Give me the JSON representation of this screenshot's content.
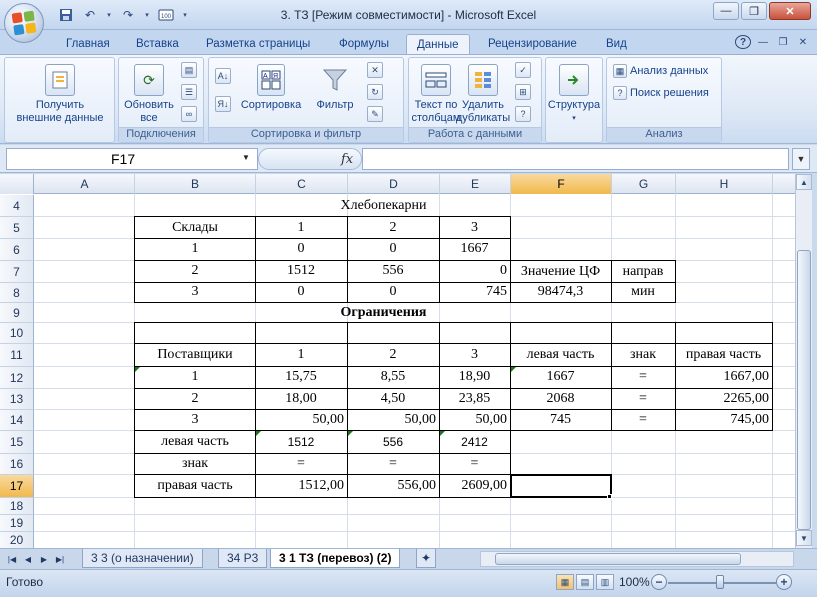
{
  "window": {
    "title": "3. ТЗ  [Режим совместимости] - Microsoft Excel"
  },
  "ribbon_tabs": [
    "Главная",
    "Вставка",
    "Разметка страницы",
    "Формулы",
    "Данные",
    "Рецензирование",
    "Вид"
  ],
  "active_tab": "Данные",
  "ribbon": {
    "get_external": "Получить\nвнешние данные",
    "refresh_all": "Обновить\nвсе",
    "connections_group": "Подключения",
    "sort_label": "Сортировка",
    "filter_label": "Фильтр",
    "sort_filter_group": "Сортировка и фильтр",
    "text_to_columns": "Текст по\nстолбцам",
    "remove_duplicates": "Удалить\nдубликаты",
    "data_tools_group": "Работа с данными",
    "outline": "Структура",
    "data_analysis": "Анализ данных",
    "solver": "Поиск решения",
    "analysis_group": "Анализ"
  },
  "formula_bar": {
    "name_box": "F17",
    "fx": "fx",
    "formula": ""
  },
  "columns": [
    "A",
    "B",
    "C",
    "D",
    "E",
    "F",
    "G",
    "H"
  ],
  "rows": [
    "4",
    "5",
    "6",
    "7",
    "8",
    "9",
    "10",
    "11",
    "12",
    "13",
    "14",
    "15",
    "16",
    "17",
    "18",
    "19",
    "20"
  ],
  "sheet": {
    "title_bakeries": "Хлебопекарни",
    "warehouses": "Склады",
    "col_1": "1",
    "col_2": "2",
    "col_3": "3",
    "row_1": "1",
    "row_2": "2",
    "row_3": "3",
    "alloc": [
      [
        "0",
        "0",
        "1667"
      ],
      [
        "1512",
        "556",
        "0"
      ],
      [
        "0",
        "0",
        "745"
      ]
    ],
    "objective_label": "Значение ЦФ",
    "direction_label": "направ",
    "objective_value": "98474,3",
    "direction_value": "мин",
    "constraints_title": "Ограничения",
    "suppliers": "Поставщики",
    "lhs_header": "левая часть",
    "sign_header": "знак",
    "rhs_header": "правая часть",
    "costs": [
      [
        "15,75",
        "8,55",
        "18,90"
      ],
      [
        "18,00",
        "4,50",
        "23,85"
      ],
      [
        "50,00",
        "50,00",
        "50,00"
      ]
    ],
    "supplier_lhs": [
      "1667",
      "2068",
      "745"
    ],
    "supplier_sign": [
      "=",
      "=",
      "="
    ],
    "supplier_rhs": [
      "1667,00",
      "2265,00",
      "745,00"
    ],
    "lhs_row_label": "левая часть",
    "lhs_row": [
      "1512",
      "556",
      "2412"
    ],
    "sign_row_label": "знак",
    "sign_row": [
      "=",
      "=",
      "="
    ],
    "rhs_row_label": "правая часть",
    "rhs_row": [
      "1512,00",
      "556,00",
      "2609,00"
    ]
  },
  "sheet_tabs": [
    "3 3 (о назначении)",
    "34 Р3",
    "3 1 ТЗ (перевоз) (2)"
  ],
  "active_sheet": "3 1 ТЗ (перевоз) (2)",
  "status": {
    "ready": "Готово",
    "zoom": "100%"
  },
  "colors": {
    "accent": "#15428b",
    "selection_header": "#f1b94c",
    "ribbon_bg": "#dbe6f5"
  }
}
